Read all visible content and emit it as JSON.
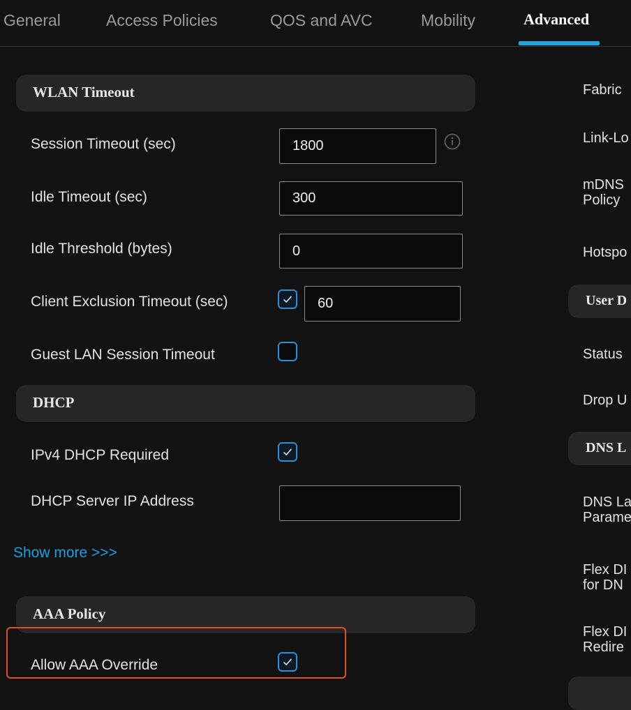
{
  "tabs": [
    {
      "label": "General",
      "active": false
    },
    {
      "label": "Access Policies",
      "active": false
    },
    {
      "label": "QOS and AVC",
      "active": false
    },
    {
      "label": "Mobility",
      "active": false
    },
    {
      "label": "Advanced",
      "active": true
    }
  ],
  "wlan_timeout": {
    "title": "WLAN Timeout",
    "session_timeout": {
      "label": "Session Timeout (sec)",
      "value": "1800"
    },
    "idle_timeout": {
      "label": "Idle Timeout (sec)",
      "value": "300"
    },
    "idle_threshold": {
      "label": "Idle Threshold (bytes)",
      "value": "0"
    },
    "client_exclusion": {
      "label": "Client Exclusion Timeout (sec)",
      "checked": true,
      "value": "60"
    },
    "guest_lan": {
      "label": "Guest LAN Session Timeout",
      "checked": false
    }
  },
  "dhcp": {
    "title": "DHCP",
    "ipv4_required": {
      "label": "IPv4 DHCP Required",
      "checked": true
    },
    "server_ip": {
      "label": "DHCP Server IP Address",
      "value": ""
    }
  },
  "show_more": "Show more >>>",
  "aaa_policy": {
    "title": "AAA Policy",
    "allow_override": {
      "label": "Allow AAA Override",
      "checked": true
    }
  },
  "right_column": {
    "fabric": "Fabric",
    "link_local": "Link-Lo",
    "mdns_line1": "mDNS",
    "mdns_line2": "Policy",
    "hotspot": "Hotspo",
    "user_header": "User D",
    "status": "Status",
    "drop": "Drop U",
    "dns_header": "DNS L",
    "dns_layer_line1": "DNS La",
    "dns_layer_line2": "Parame",
    "flex_dns_line1": "Flex DI",
    "flex_dns_line2": "for DN",
    "flex_redirect_line1": "Flex DI",
    "flex_redirect_line2": "Redire"
  },
  "colors": {
    "accent": "#1fa7e0",
    "highlight": "#e0502e"
  }
}
